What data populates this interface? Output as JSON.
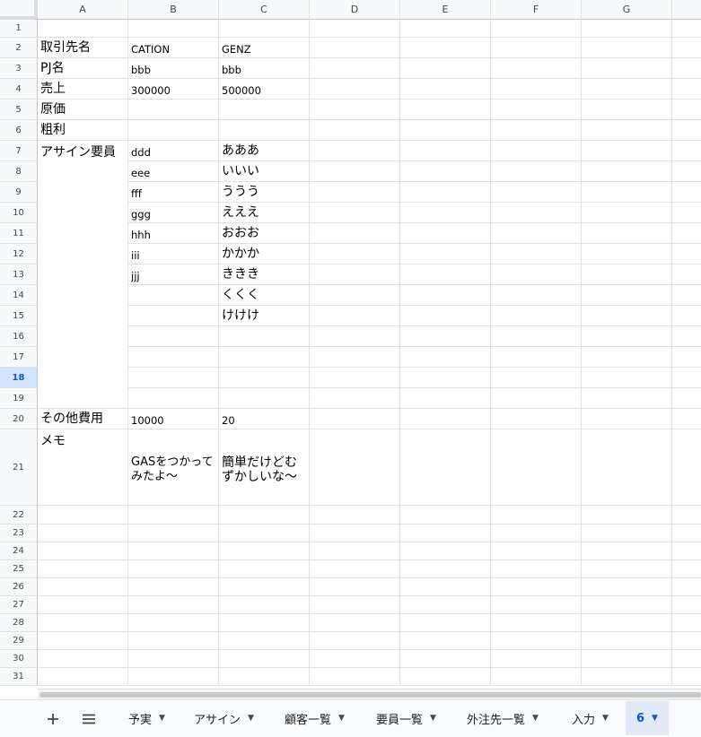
{
  "sheet": {
    "columns": [
      "A",
      "B",
      "C",
      "D",
      "E",
      "F",
      "G"
    ],
    "rows": [
      "1",
      "2",
      "3",
      "4",
      "5",
      "6",
      "7",
      "8",
      "9",
      "10",
      "11",
      "12",
      "13",
      "14",
      "15",
      "16",
      "17",
      "18",
      "19",
      "20",
      "21",
      "22",
      "23",
      "24",
      "25",
      "26",
      "27",
      "28",
      "29",
      "30",
      "31"
    ],
    "selected_row": "18",
    "cells": {
      "A2": "取引先名",
      "B2": "CATION",
      "C2": "GENZ",
      "A3": "PJ名",
      "B3": "bbb",
      "C3": "bbb",
      "A4": "売上",
      "B4": "300000",
      "C4": "500000",
      "A5": "原価",
      "A6": "粗利",
      "A7": "アサイン要員",
      "B7": "ddd",
      "C7": "あああ",
      "B8": "eee",
      "C8": "いいい",
      "B9": "fff",
      "C9": "ううう",
      "B10": "ggg",
      "C10": "えええ",
      "B11": "hhh",
      "C11": "おおお",
      "B12": "iii",
      "C12": "かかか",
      "B13": "jjj",
      "C13": "ききき",
      "C14": "くくく",
      "C15": "けけけ",
      "A20": "その他費用",
      "B20": "10000",
      "C20": "20",
      "A21": "メモ",
      "B21": "GASをつかってみたよ〜",
      "C21": "簡単だけどむずかしいな〜"
    }
  },
  "tabbar": {
    "add_icon": "plus-icon",
    "list_icon": "menu-icon",
    "tabs": [
      {
        "label": "予実"
      },
      {
        "label": "アサイン"
      },
      {
        "label": "顧客一覧"
      },
      {
        "label": "要員一覧"
      },
      {
        "label": "外注先一覧"
      },
      {
        "label": "入力"
      },
      {
        "label": "6"
      }
    ],
    "active_tab": "6"
  }
}
